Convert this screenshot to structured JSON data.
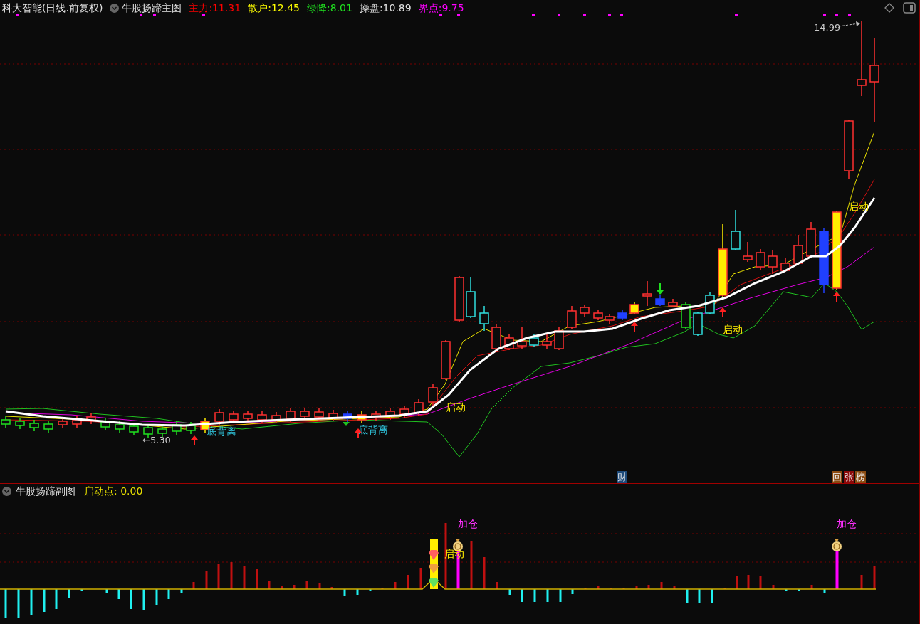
{
  "header": {
    "stock_title": "科大智能(日线.前复权)",
    "indicator": "牛股扬蹄主图",
    "readings": [
      {
        "label": "主力:",
        "value": "11.31",
        "color": "#ff0000"
      },
      {
        "label": "散户:",
        "value": "12.45",
        "color": "#ffff00"
      },
      {
        "label": "绿降:",
        "value": "8.01",
        "color": "#20e020"
      },
      {
        "label": "操盘:",
        "value": "10.89",
        "color": "#e0e0e0"
      },
      {
        "label": "界点:",
        "value": "9.75",
        "color": "#ff00ff"
      }
    ]
  },
  "main_chart": {
    "price_markers": [
      {
        "text": "←5.30"
      },
      {
        "text": "14.99"
      }
    ],
    "signals": [
      {
        "kind": "divergence",
        "text": "底背离"
      },
      {
        "kind": "divergence",
        "text": "底背离"
      },
      {
        "kind": "launch",
        "text": "启动"
      },
      {
        "kind": "launch",
        "text": "启动"
      },
      {
        "kind": "launch",
        "text": "启动"
      }
    ],
    "badges": [
      {
        "text": "财",
        "color": "#1d4a7a"
      },
      {
        "text": "回",
        "color": "#8a4a10"
      },
      {
        "text": "张",
        "color": "#8b0a0a"
      },
      {
        "text": "榜",
        "color": "#8a4a10"
      }
    ]
  },
  "sub_chart": {
    "title": "牛股扬蹄副图",
    "reading": "启动点: 0.00",
    "signals": [
      {
        "kind": "launch",
        "text": "启动"
      },
      {
        "kind": "add",
        "text": "加仓"
      },
      {
        "kind": "add",
        "text": "加仓"
      }
    ]
  }
}
